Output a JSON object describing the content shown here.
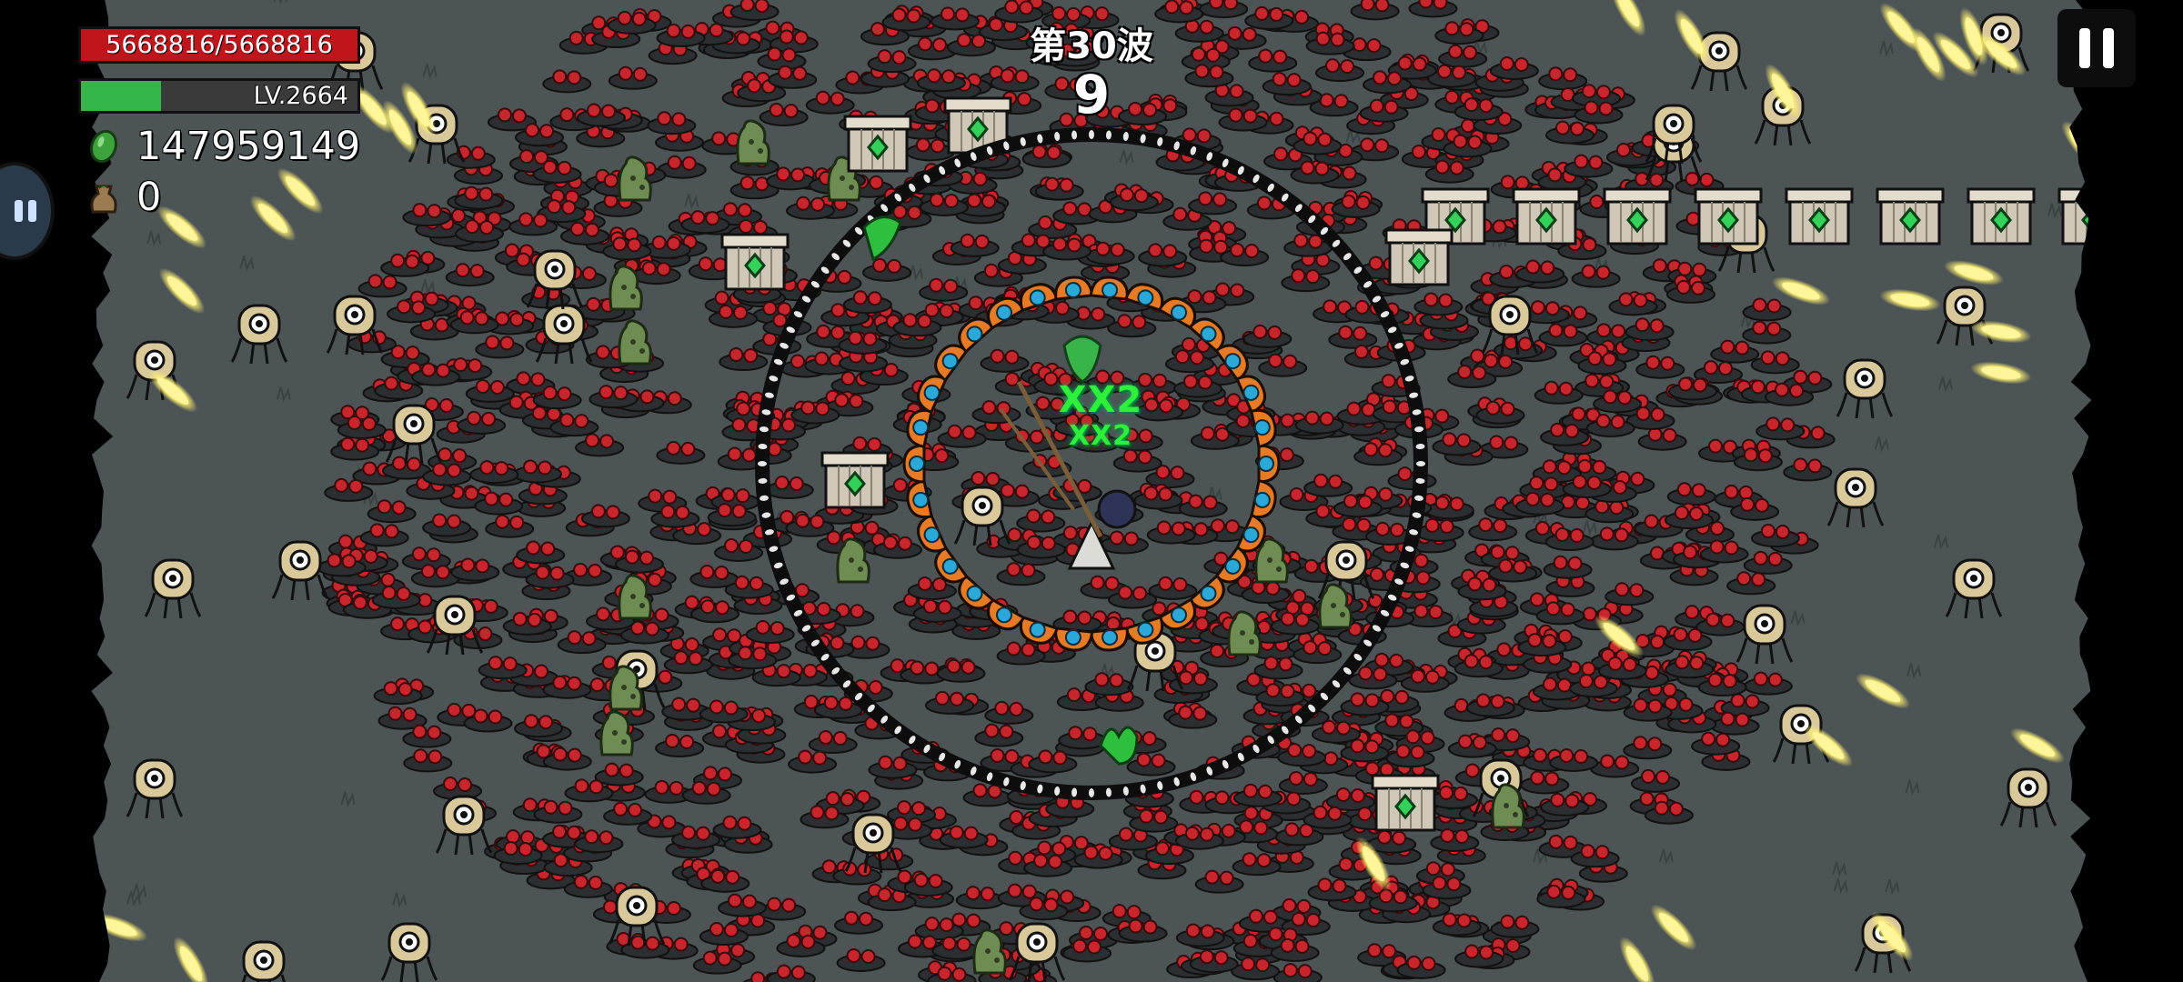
{
  "hud": {
    "hp_text": "5668816/5668816",
    "hp_fraction": 1.0,
    "level_text": "LV.2664",
    "xp_fraction": 0.29,
    "coins": "147959149",
    "bags": "0"
  },
  "wave": {
    "title": "第30波",
    "countdown": "9"
  },
  "combo": {
    "line1": "XX2",
    "line2": "XX2"
  },
  "icons": {
    "pause": "pause-icon",
    "coin": "green-coin-icon",
    "bag": "loot-bag-icon",
    "side": "controller-icon"
  },
  "colors": {
    "hp": "#c0161b",
    "xp": "#33b54a",
    "ground": "#4d5456",
    "enemy_red": "#c8262c",
    "projectile": "#fff59a"
  }
}
